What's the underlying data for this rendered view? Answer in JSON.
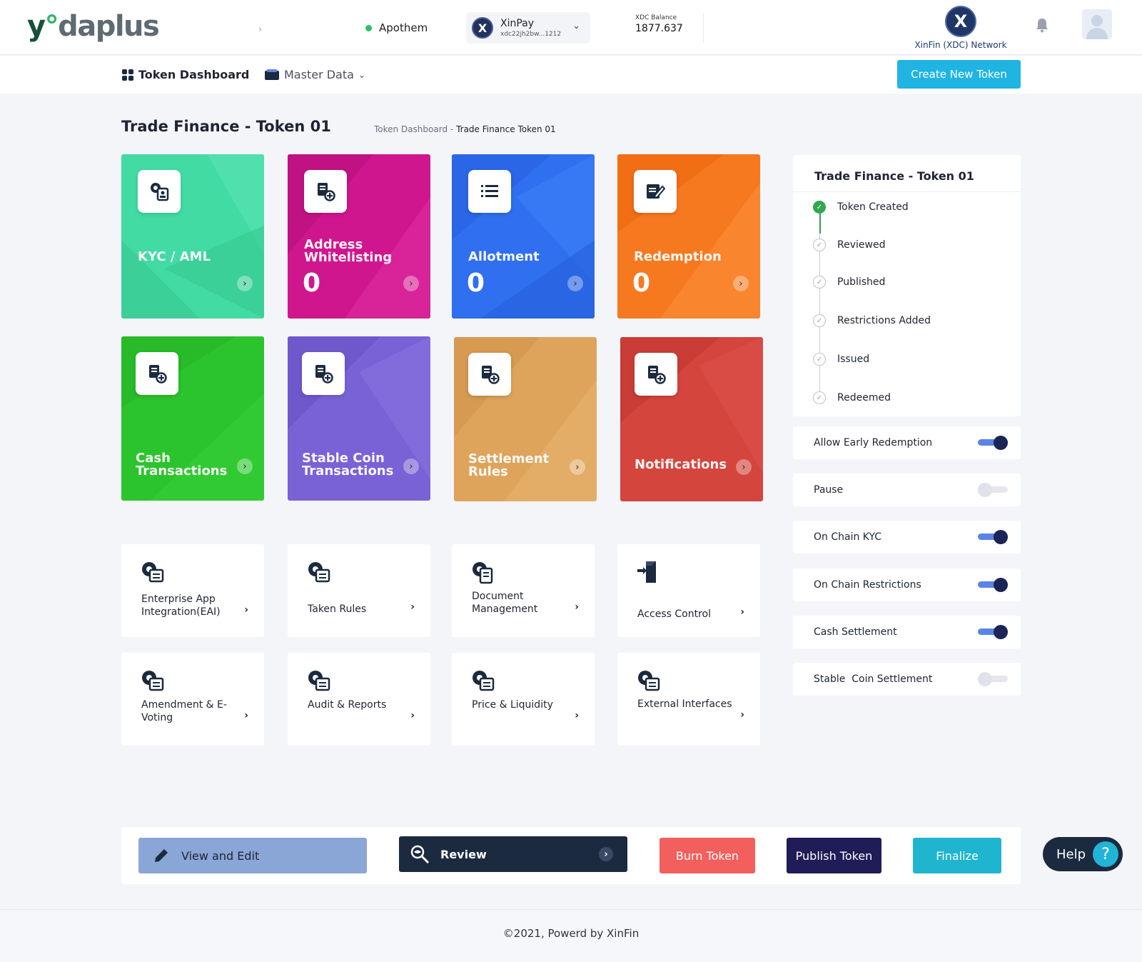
{
  "header": {
    "logo": {
      "part1": "y",
      "part2": "daplus"
    },
    "network_status": "Apothem",
    "wallet": {
      "name": "XinPay",
      "address": "xdc22jh2bw...1212",
      "coin_letter": "X"
    },
    "balance": {
      "label": "XDC Balance",
      "value": "1877.637"
    },
    "network": {
      "letter": "X",
      "label": "XinFin (XDC) Network"
    }
  },
  "nav": {
    "dashboard": "Token Dashboard",
    "master_data": "Master Data",
    "create_button": "Create New Token"
  },
  "page": {
    "title": "Trade Finance - Token 01",
    "breadcrumb": {
      "parent": "Token Dashboard",
      "separator": "-",
      "current": "Trade Finance Token 01"
    }
  },
  "tiles": [
    {
      "label": "KYC / AML",
      "count": "",
      "color": "#3ed9a0"
    },
    {
      "label": "Address Whitelisting",
      "count": "0",
      "color": "#d11592"
    },
    {
      "label": "Allotment",
      "count": "0",
      "color": "#2f72f0"
    },
    {
      "label": "Redemption",
      "count": "0",
      "color": "#f7791f"
    },
    {
      "label": "Cash Transactions",
      "count": "",
      "color": "#2ec52e"
    },
    {
      "label": "Stable Coin Transactions",
      "count": "",
      "color": "#7a63d6"
    },
    {
      "label": "Settlement Rules",
      "count": "",
      "color": "#dea35b"
    },
    {
      "label": "Notifications",
      "count": "",
      "color": "#d4453d"
    }
  ],
  "cards": [
    {
      "label": "Enterprise App Integration(EAI)",
      "icon": "gear-list-icon"
    },
    {
      "label": "Taken Rules",
      "icon": "gear-list-icon"
    },
    {
      "label": "Document Management",
      "icon": "gear-doc-icon"
    },
    {
      "label": "Access Control",
      "icon": "access-icon"
    },
    {
      "label": "Amendment & E-Voting",
      "icon": "gear-list-icon"
    },
    {
      "label": "Audit & Reports",
      "icon": "gear-list-icon"
    },
    {
      "label": "Price & Liquidity",
      "icon": "gear-list-icon"
    },
    {
      "label": "External Interfaces",
      "icon": "gear-list-icon"
    }
  ],
  "status_panel": {
    "title": "Trade Finance - Token 01",
    "steps": [
      {
        "label": "Token Created",
        "done": true
      },
      {
        "label": "Reviewed",
        "done": false
      },
      {
        "label": "Published",
        "done": false
      },
      {
        "label": "Restrictions Added",
        "done": false
      },
      {
        "label": "Issued",
        "done": false
      },
      {
        "label": "Redeemed",
        "done": false
      }
    ]
  },
  "toggles": [
    {
      "label": "Allow Early Redemption",
      "on": true
    },
    {
      "label": "Pause",
      "on": false
    },
    {
      "label": "On Chain KYC",
      "on": true
    },
    {
      "label": "On Chain Restrictions",
      "on": true
    },
    {
      "label": "Cash Settlement",
      "on": true
    },
    {
      "label": "Stable  Coin Settlement",
      "on": false
    }
  ],
  "actions": {
    "view_edit": "View and Edit",
    "review": "Review",
    "burn": "Burn Token",
    "publish": "Publish Token",
    "finalize": "Finalize",
    "help": "Help",
    "help_icon": "?"
  },
  "footer": "©2021, Powerd by XinFin"
}
